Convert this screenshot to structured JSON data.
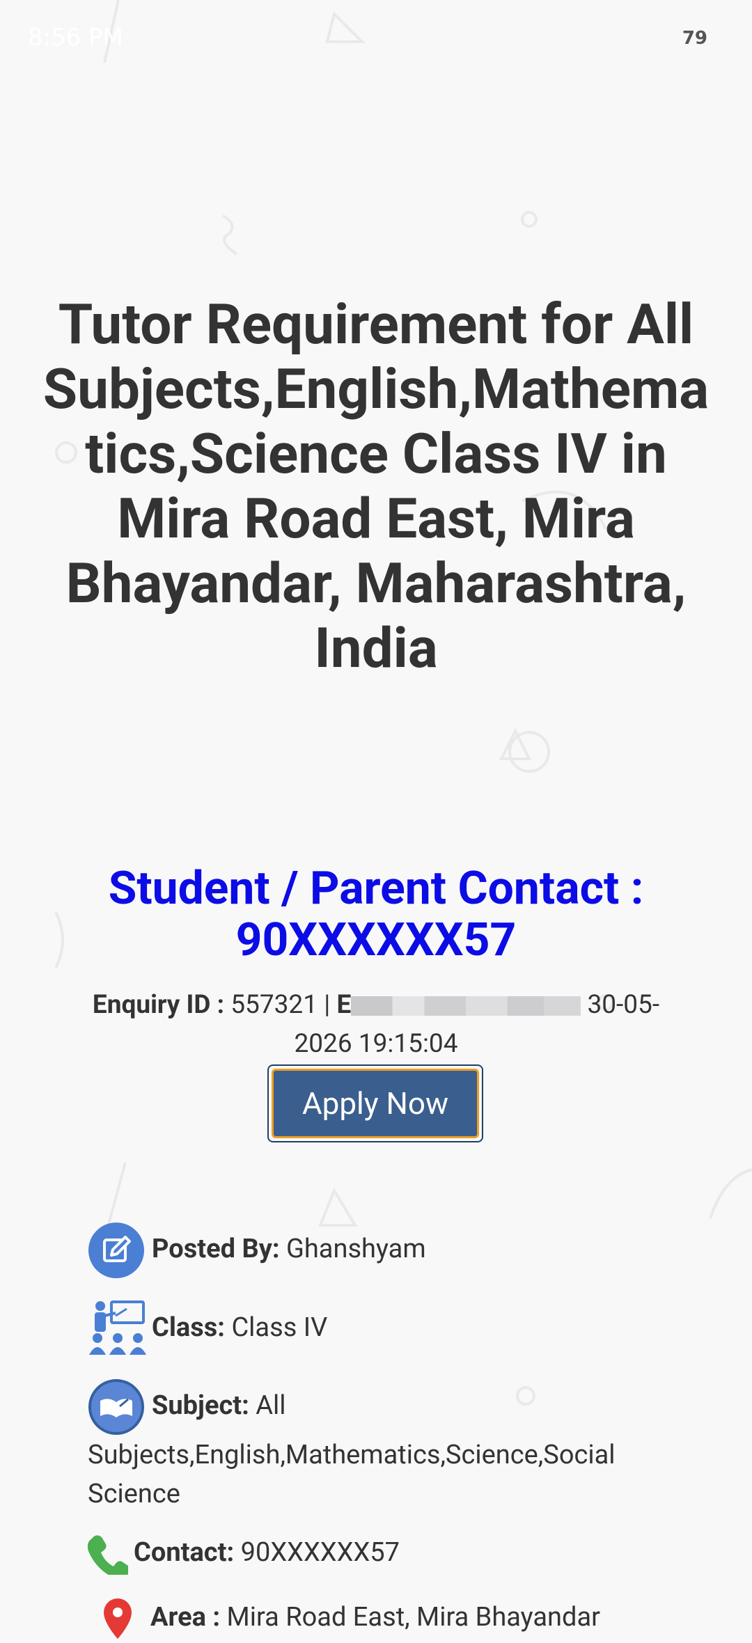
{
  "status": {
    "time": "8:56 PM",
    "battery": "79"
  },
  "title": "Tutor Requirement for All Subjects,English,Mathematics,Science Class IV in Mira Road East, Mira Bhayandar, Maharashtra, India",
  "contact_heading": "Student / Parent Contact : 90XXXXXX57",
  "enquiry": {
    "id_label": "Enquiry ID :",
    "id_value": "557321",
    "separator": "|",
    "date_label_visible": "E",
    "date_value": "30-05-2026 19:15:04"
  },
  "apply_button": "Apply Now",
  "details": {
    "posted_by_label": "Posted By:",
    "posted_by_value": "Ghanshyam",
    "class_label": "Class:",
    "class_value": "Class IV",
    "subject_label": "Subject:",
    "subject_value": "All Subjects,English,Mathematics,Science,Social Science",
    "contact_label": "Contact:",
    "contact_value": "90XXXXXX57",
    "area_label": "Area :",
    "area_value": "Mira Road East, Mira Bhayandar"
  },
  "colors": {
    "contact_heading": "#0c0ce6",
    "button_bg": "#3a5f8e",
    "button_border": "#f0a020",
    "icon_blue": "#4a7fd4",
    "phone_green": "#4caf50",
    "pin_red": "#e53935"
  }
}
